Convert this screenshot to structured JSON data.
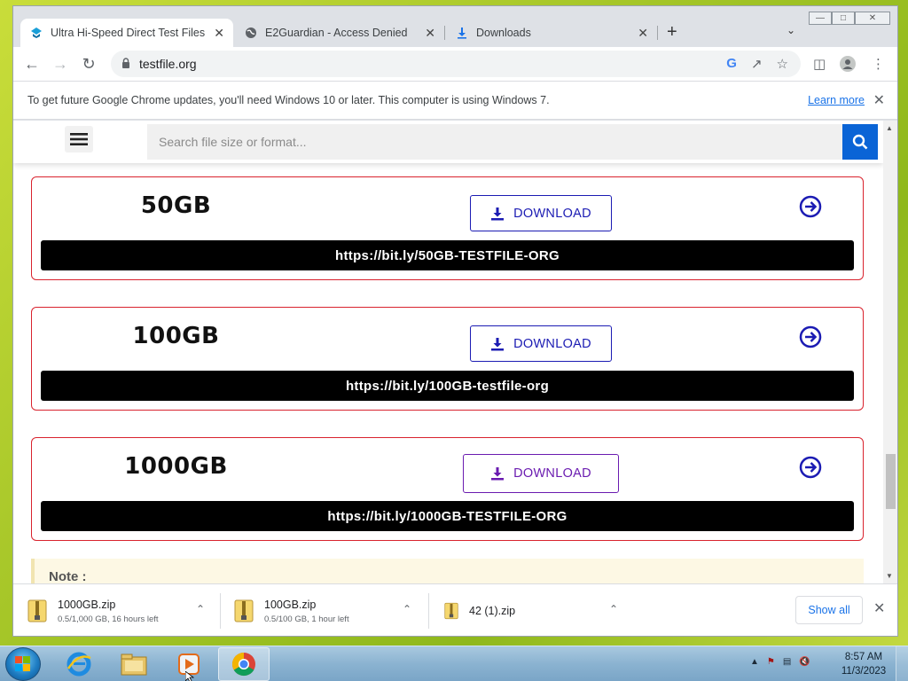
{
  "browser": {
    "tabs": [
      {
        "title": "Ultra Hi-Speed Direct Test Files D",
        "icon": "site-icon",
        "active": true
      },
      {
        "title": "E2Guardian - Access Denied",
        "icon": "globe-icon",
        "active": false
      },
      {
        "title": "Downloads",
        "icon": "download-icon",
        "active": false
      }
    ],
    "new_tab": "+",
    "url": "testfile.org",
    "infobar": {
      "message": "To get future Google Chrome updates, you'll need Windows 10 or later. This computer is using Windows 7.",
      "learn_more": "Learn more"
    }
  },
  "site": {
    "search": {
      "placeholder": "Search file size or format..."
    },
    "accent": "#0a64d6",
    "cards": [
      {
        "size": "50GB",
        "button": "DOWNLOAD",
        "link": "https://bit.ly/50GB-TESTFILE-ORG"
      },
      {
        "size": "100GB",
        "button": "DOWNLOAD",
        "link": "https://bit.ly/100GB-testfile-org"
      },
      {
        "size": "1000GB",
        "button": "DOWNLOAD",
        "link": "https://bit.ly/1000GB-TESTFILE-ORG"
      }
    ],
    "note_label": "Note :"
  },
  "downloads": {
    "items": [
      {
        "name": "1000GB.zip",
        "status": "0.5/1,000 GB, 16 hours left"
      },
      {
        "name": "100GB.zip",
        "status": "0.5/100 GB, 1 hour left"
      },
      {
        "name": "42 (1).zip",
        "status": ""
      }
    ],
    "show_all": "Show all"
  },
  "taskbar": {
    "time": "8:57 AM",
    "date": "11/3/2023"
  }
}
